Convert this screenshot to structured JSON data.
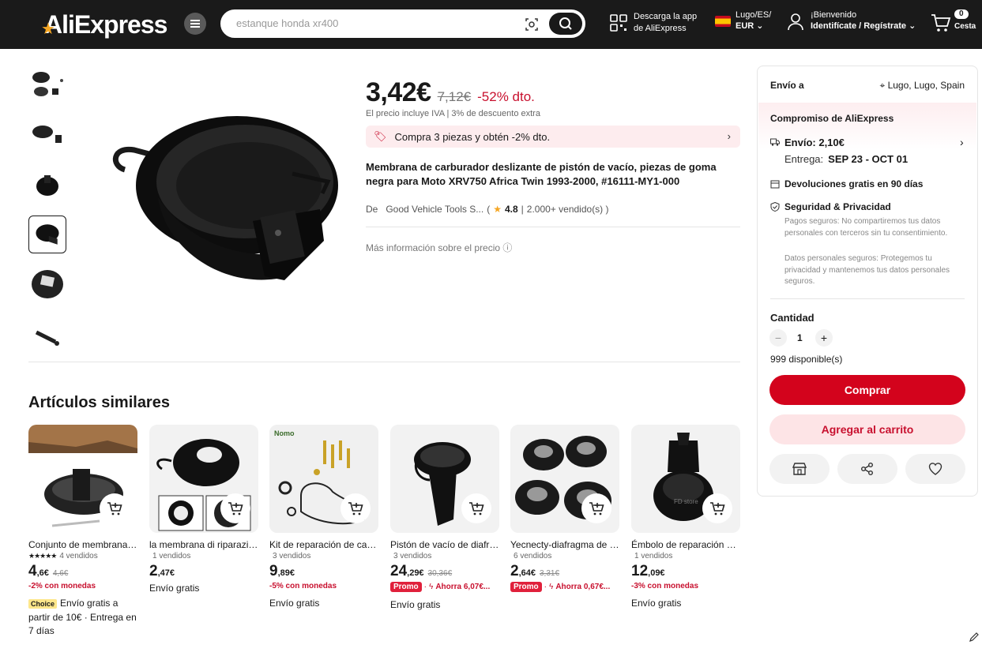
{
  "header": {
    "logo": "AliExpress",
    "search_placeholder": "estanque honda xr400",
    "app_line1": "Descarga la app",
    "app_line2": "de AliExpress",
    "region_line1": "Lugo/ES/",
    "region_line2": "EUR",
    "user_line1": "¡Bienvenido",
    "user_line2": "Identifícate / Regístrate",
    "cart_count": "0",
    "cart_label": "Cesta"
  },
  "product": {
    "price": "3,42€",
    "old_price": "7,12€",
    "discount": "-52% dto.",
    "vat_note": "El precio incluye IVA  |  3% de descuento extra",
    "promo_text": "Compra 3 piezas y obtén -2% dto.",
    "title": "Membrana de carburador deslizante de pistón de vacío, piezas de goma negra para Moto XRV750 Africa Twin 1993-2000, #16111-MY1-000",
    "store_name": "De   Good Vehicle Tools S...",
    "rating": "4.8",
    "sold": "2.000+ vendido(s) )",
    "more_info": "Más información sobre el precio"
  },
  "panel": {
    "ship_to_label": "Envío a",
    "ship_location": "Lugo, Lugo, Spain",
    "commitment_title": "Compromiso de AliExpress",
    "shipping_cost": "Envío: 2,10€",
    "delivery_label": "Entrega:",
    "delivery_dates": "SEP 23 - OCT 01",
    "returns": "Devoluciones gratis en 90 días",
    "security_title": "Seguridad & Privacidad",
    "security_note1": "Pagos seguros: No compartiremos tus datos personales con terceros sin tu consentimiento.",
    "security_note2": "Datos personales seguros: Protegemos tu privacidad y mantenemos tus datos personales seguros.",
    "quantity_label": "Cantidad",
    "quantity_value": "1",
    "available": "999 disponible(s)",
    "buy_label": "Comprar",
    "add_to_cart_label": "Agregar al carrito"
  },
  "similar": {
    "title": "Artículos similares",
    "items": [
      {
        "name": "Conjunto de membrana de carburador",
        "sold": "4 vendidos",
        "stars": "★★★★★",
        "price_int": "4",
        "price_dec": ",6€",
        "old_price": "4,6€",
        "coin": "-2% con monedas",
        "choice": "Choice",
        "shipping": "Envío gratis a partir de 10€ · Entrega en 7 días"
      },
      {
        "name": "la membrana di riparazione",
        "sold": "1 vendidos",
        "price_int": "2",
        "price_dec": ",47€",
        "shipping": "Envío gratis"
      },
      {
        "name": "Kit de reparación de carburador",
        "sold": "3 vendidos",
        "price_int": "9",
        "price_dec": ",89€",
        "coin": "-5% con monedas",
        "shipping": "Envío gratis"
      },
      {
        "name": "Pistón de vacío de diafragma",
        "sold": "3 vendidos",
        "price_int": "24",
        "price_dec": ",29€",
        "old_price": "30,36€",
        "promo_badge": "Promo",
        "promo_text": "Ahorra 6,07€...",
        "shipping": "Envío gratis"
      },
      {
        "name": "Yecnecty-diafragma de carburador",
        "sold": "6 vendidos",
        "price_int": "2",
        "price_dec": ",64€",
        "old_price": "3,31€",
        "promo_badge": "Promo",
        "promo_text": "Ahorra 0,67€...",
        "shipping": ""
      },
      {
        "name": "Émbolo de reparación de carburador",
        "sold": "1 vendidos",
        "price_int": "12",
        "price_dec": ",09€",
        "coin": "-3% con monedas",
        "shipping": "Envío gratis"
      }
    ]
  },
  "colors": {
    "accent": "#d3031c",
    "header_bg": "#1a1a1a",
    "discount": "#c8102e"
  },
  "icons": [
    "menu-icon",
    "camera-search-icon",
    "search-icon",
    "qr-code-icon",
    "user-icon",
    "cart-icon",
    "location-pin-icon",
    "truck-icon",
    "return-icon",
    "shield-icon",
    "store-icon",
    "share-icon",
    "heart-icon",
    "add-to-cart-icon",
    "star-icon",
    "edit-icon"
  ]
}
